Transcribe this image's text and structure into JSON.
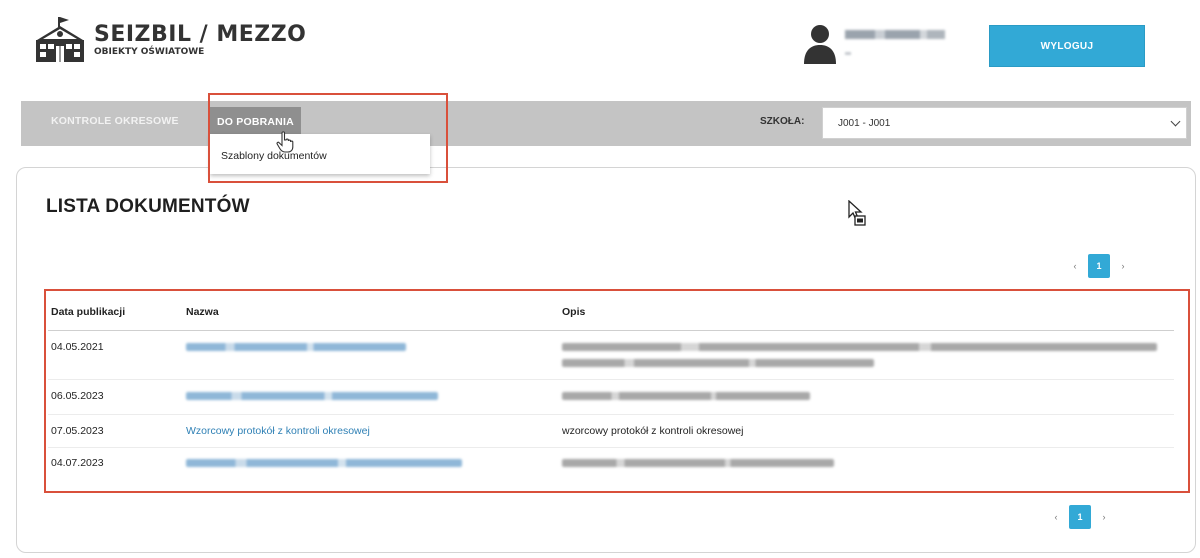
{
  "header": {
    "app_title": "SEIZBIL / MEZZO",
    "app_subtitle": "OBIEKTY OŚWIATOWE",
    "logout_label": "WYLOGUJ"
  },
  "nav": {
    "items": [
      {
        "label": "KONTROLE OKRESOWE"
      },
      {
        "label": "DO POBRANIA"
      }
    ],
    "dropdown_items": [
      {
        "label": "Szablony dokumentów"
      }
    ],
    "school_label": "SZKOŁA:",
    "school_value": "J001 - J001"
  },
  "main": {
    "heading": "LISTA DOKUMENTÓW",
    "pagination": {
      "prev": "‹",
      "current": "1",
      "next": "›"
    },
    "table": {
      "columns": [
        "Data publikacji",
        "Nazwa",
        "Opis"
      ],
      "rows": [
        {
          "date": "04.05.2021",
          "name": "",
          "description": ""
        },
        {
          "date": "06.05.2023",
          "name": "",
          "description": ""
        },
        {
          "date": "07.05.2023",
          "name": "Wzorcowy protokół z kontroli okresowej",
          "description": "wzorcowy protokół z kontroli okresowej"
        },
        {
          "date": "04.07.2023",
          "name": "",
          "description": ""
        }
      ]
    }
  },
  "colors": {
    "accent": "#32a9d6",
    "nav_bg": "#c4c4c4",
    "nav_active": "#8f8f8f",
    "highlight": "#d9503b",
    "link": "#2f80b5"
  },
  "icons": [
    "school-building-icon",
    "user-avatar-icon",
    "chevron-down-icon",
    "hand-pointer-icon",
    "move-cursor-icon"
  ]
}
